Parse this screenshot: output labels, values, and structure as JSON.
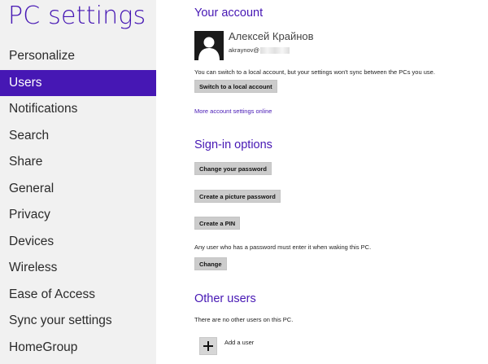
{
  "sidebar": {
    "title": "PC settings",
    "items": [
      {
        "label": "Personalize"
      },
      {
        "label": "Users"
      },
      {
        "label": "Notifications"
      },
      {
        "label": "Search"
      },
      {
        "label": "Share"
      },
      {
        "label": "General"
      },
      {
        "label": "Privacy"
      },
      {
        "label": "Devices"
      },
      {
        "label": "Wireless"
      },
      {
        "label": "Ease of Access"
      },
      {
        "label": "Sync your settings"
      },
      {
        "label": "HomeGroup"
      }
    ],
    "active_index": 1
  },
  "account": {
    "heading": "Your account",
    "user_name": "Алексей Крайнов",
    "email_visible": "akraynov@",
    "local_note": "You can switch to a local account, but your settings won't sync between the PCs you use.",
    "switch_button": "Switch to a local account",
    "more_link": "More account settings online"
  },
  "signin": {
    "heading": "Sign-in options",
    "change_password_button": "Change your password",
    "picture_password_button": "Create a picture password",
    "pin_button": "Create a PIN",
    "wake_note": "Any user who has a password must enter it when waking this PC.",
    "change_button": "Change"
  },
  "other_users": {
    "heading": "Other users",
    "note": "There are no other users on this PC.",
    "add_label": "Add a user"
  },
  "colors": {
    "accent": "#4617b4",
    "sidebar_bg": "#f1f1f1",
    "button_bg": "#cccccc"
  },
  "icons": {
    "avatar": "user-silhouette-icon",
    "add": "plus-icon"
  }
}
